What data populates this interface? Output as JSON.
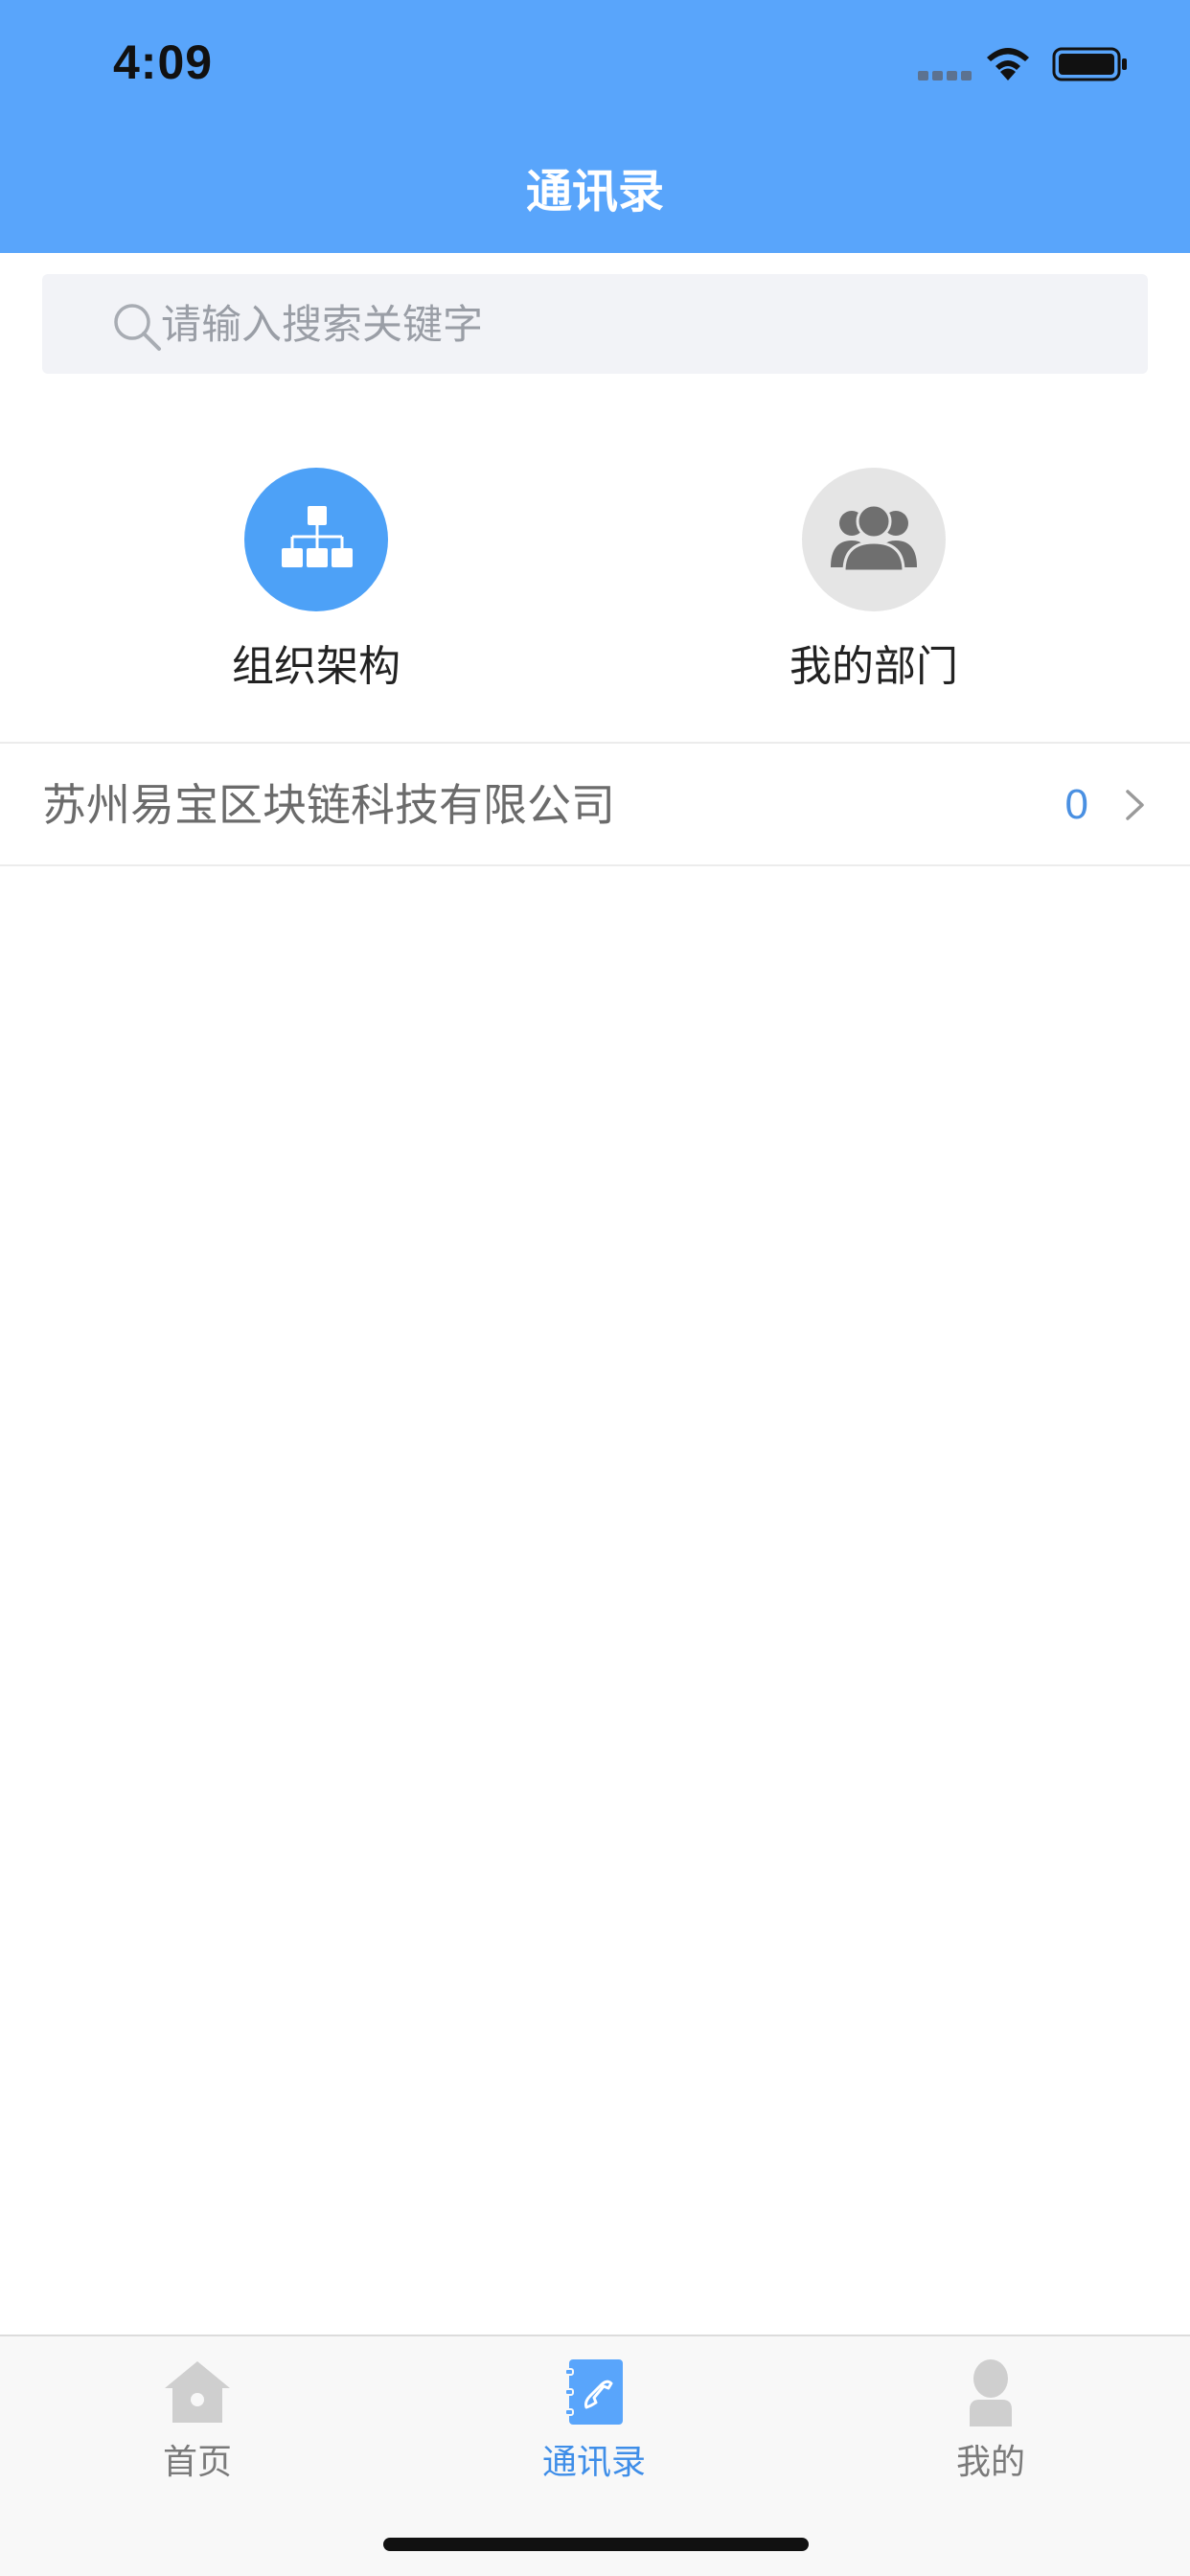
{
  "status_bar": {
    "time": "4:09"
  },
  "nav": {
    "title": "通讯录"
  },
  "search": {
    "placeholder": "请输入搜索关键字"
  },
  "quick_entries": [
    {
      "label": "组织架构",
      "icon": "org-chart-icon",
      "color": "#4da1f7"
    },
    {
      "label": "我的部门",
      "icon": "group-users-icon",
      "color": "#e5e5e5"
    }
  ],
  "company": {
    "name": "苏州易宝区块链科技有限公司",
    "count": "0"
  },
  "tabbar": {
    "items": [
      {
        "label": "首页",
        "icon": "home-icon",
        "active": false
      },
      {
        "label": "通讯录",
        "icon": "contacts-book-icon",
        "active": true
      },
      {
        "label": "我的",
        "icon": "user-icon",
        "active": false
      }
    ]
  },
  "colors": {
    "header": "#59a5fb",
    "accent": "#3f8ee8",
    "search_bg": "#f2f3f7"
  }
}
